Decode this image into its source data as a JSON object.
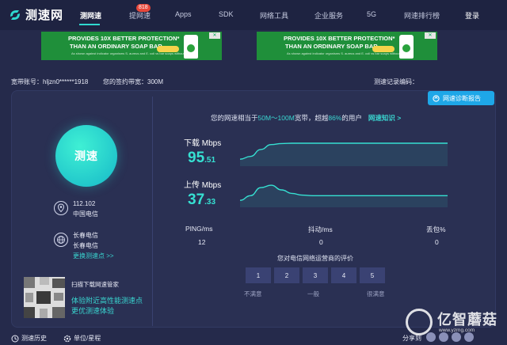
{
  "brand": {
    "name": "测速网"
  },
  "nav": {
    "items": [
      "测网速",
      "提网速",
      "Apps",
      "SDK",
      "网络工具",
      "企业服务",
      "5G",
      "网速排行榜"
    ],
    "badge": "818",
    "login": "登录"
  },
  "ads": [
    {
      "line1": "PROVIDES 10X BETTER PROTECTION*",
      "line2": "THAN AN ORDINARY SOAP BAR",
      "line3": "As shown against indicator organisms S. aureus and E. coli vs bar soaps without actives."
    },
    {
      "line1": "PROVIDES 10X BETTER PROTECTION*",
      "line2": "THAN AN ORDINARY SOAP BAR",
      "line3": "As shown against indicator organisms S. aureus and E. coli vs bar soaps without actives."
    }
  ],
  "account": {
    "label": "宽带账号：",
    "value": "hljzn0******1918",
    "bandwidth_label": "您的签约带宽：",
    "bandwidth_value": "300M",
    "record_label": "测速记录编码："
  },
  "diagnosis_button": "网速诊断报告",
  "test_button": "测速",
  "location": {
    "ip": "112.102",
    "isp": "中国电信",
    "node_city": "长春电信",
    "node_isp": "长春电信",
    "change_node": "更换测速点 >>"
  },
  "scan": {
    "title": "扫描下载网速管家",
    "line1": "体验附近高性能测速点",
    "line2": "更优测速体验"
  },
  "summary": {
    "prefix": "您的网速相当于",
    "range": "50M～100M",
    "mid": "宽带，超越",
    "percent": "86%",
    "suffix": "的用户",
    "link": "网速知识 >"
  },
  "download": {
    "label": "下载 Mbps",
    "int": "95",
    "dec": ".51"
  },
  "upload": {
    "label": "上传 Mbps",
    "int": "37",
    "dec": ".33"
  },
  "stats": {
    "ping_label": "PING/ms",
    "ping_value": "12",
    "jitter_label": "抖动/ms",
    "jitter_value": "0",
    "loss_label": "丢包%",
    "loss_value": "0"
  },
  "rating": {
    "question": "您对电信网络运营商的评价",
    "options": [
      "1",
      "2",
      "3",
      "4",
      "5"
    ],
    "low": "不满意",
    "mid": "一般",
    "high": "很满意"
  },
  "footer": {
    "history": "测速历史",
    "unit": "单位/星程",
    "share": "分享到"
  },
  "watermark": {
    "text": "亿智蘑菇",
    "url": "www.yzmg.com"
  },
  "colors": {
    "accent": "#36e0d2",
    "panel": "#2a3053",
    "background": "#252a4b",
    "button": "#1ea7e8"
  },
  "chart_data": [
    {
      "type": "area",
      "name": "download",
      "x": [
        0,
        1,
        2,
        3,
        4,
        5,
        6,
        7,
        8,
        9,
        10,
        11,
        12,
        13,
        14,
        15,
        16,
        17,
        18,
        19,
        20
      ],
      "values": [
        20,
        28,
        48,
        62,
        65,
        66,
        66,
        66,
        66,
        66,
        66,
        66,
        66,
        66,
        66,
        66,
        66,
        66,
        66,
        66,
        66
      ],
      "ylim": [
        0,
        100
      ]
    },
    {
      "type": "area",
      "name": "upload",
      "x": [
        0,
        1,
        2,
        3,
        4,
        5,
        6,
        7,
        8,
        9,
        10,
        11,
        12,
        13,
        14,
        15,
        16,
        17,
        18,
        19,
        20
      ],
      "values": [
        12,
        20,
        34,
        38,
        30,
        24,
        21,
        20,
        20,
        20,
        20,
        20,
        20,
        20,
        20,
        20,
        20,
        20,
        20,
        20,
        20
      ],
      "ylim": [
        0,
        60
      ]
    }
  ]
}
